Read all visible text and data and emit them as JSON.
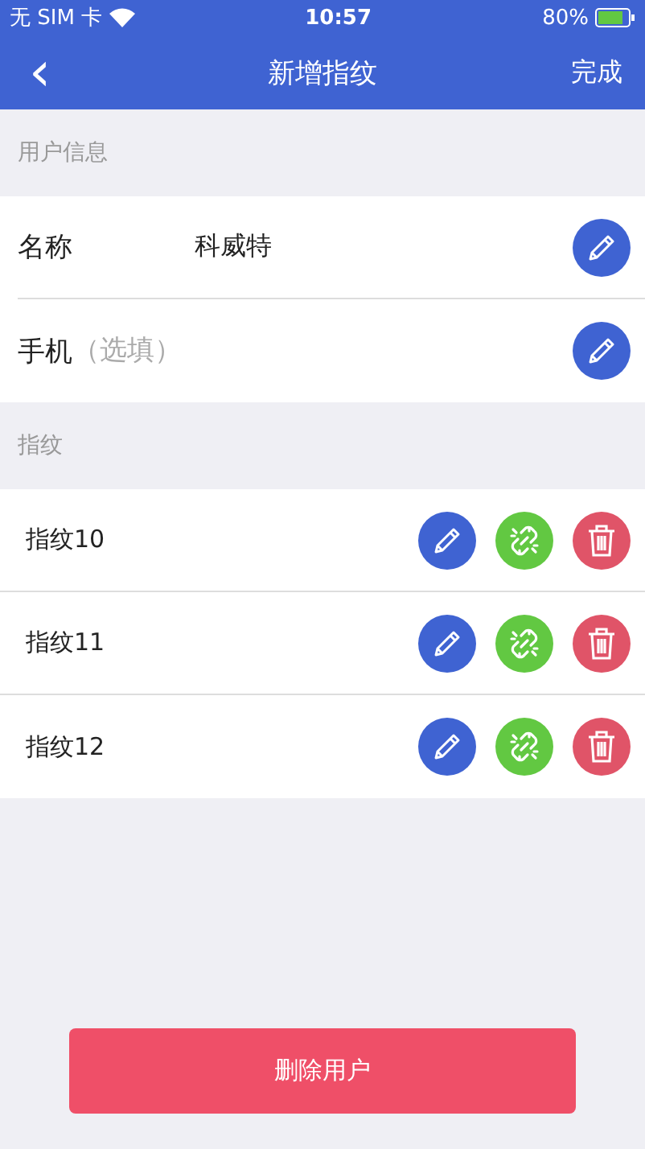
{
  "status_bar": {
    "carrier": "无 SIM 卡",
    "time": "10:57",
    "battery": "80%"
  },
  "nav": {
    "back": "‹",
    "title": "新增指纹",
    "done": "完成"
  },
  "user_section": {
    "title": "用户信息",
    "fields": [
      {
        "label": "名称",
        "value": "科威特"
      },
      {
        "label": "手机",
        "placeholder": "（选填）"
      }
    ]
  },
  "fingerprint_section": {
    "title": "指纹",
    "items": [
      {
        "name": "指纹10"
      },
      {
        "name": "指纹11"
      },
      {
        "name": "指纹12"
      }
    ]
  },
  "delete_button": "删除用户"
}
